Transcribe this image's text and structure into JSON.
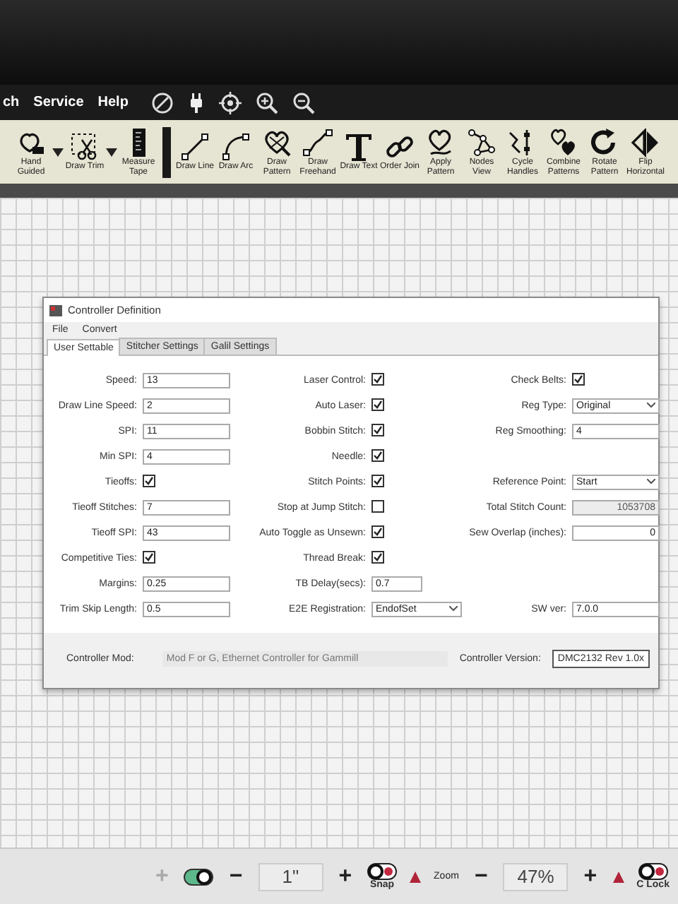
{
  "menu_bar": {
    "items": [
      "ch",
      "Service",
      "Help"
    ]
  },
  "toolbar": {
    "tools": [
      {
        "label": "Hand Guided",
        "dropdown": true
      },
      {
        "label": "Draw Trim",
        "dropdown": true
      },
      {
        "label": "Measure Tape",
        "dropdown": false
      },
      {
        "label": "Draw Line",
        "dropdown": false
      },
      {
        "label": "Draw Arc",
        "dropdown": false
      },
      {
        "label": "Draw Pattern",
        "dropdown": false
      },
      {
        "label": "Draw Freehand",
        "dropdown": false
      },
      {
        "label": "Draw Text",
        "dropdown": false
      },
      {
        "label": "Order Join",
        "dropdown": false
      },
      {
        "label": "Apply Pattern",
        "dropdown": false
      },
      {
        "label": "Nodes View",
        "dropdown": false
      },
      {
        "label": "Cycle Handles",
        "dropdown": false
      },
      {
        "label": "Combine Patterns",
        "dropdown": false
      },
      {
        "label": "Rotate Pattern",
        "dropdown": false
      },
      {
        "label": "Flip Horizontal",
        "dropdown": false
      }
    ]
  },
  "dialog": {
    "title": "Controller Definition",
    "menu": [
      "File",
      "Convert"
    ],
    "tabs": [
      {
        "label": "User Settable",
        "selected": true
      },
      {
        "label": "Stitcher Settings",
        "selected": false
      },
      {
        "label": "Galil Settings",
        "selected": false
      }
    ],
    "rows": [
      [
        {
          "label": "Speed:",
          "kind": "text",
          "value": "13"
        },
        {
          "label": "Laser Control:",
          "kind": "check",
          "checked": true
        },
        {
          "label": "Check Belts:",
          "kind": "check",
          "checked": true
        }
      ],
      [
        {
          "label": "Draw Line Speed:",
          "kind": "text",
          "value": "2"
        },
        {
          "label": "Auto Laser:",
          "kind": "check",
          "checked": true
        },
        {
          "label": "Reg Type:",
          "kind": "select",
          "value": "Original"
        }
      ],
      [
        {
          "label": "SPI:",
          "kind": "text",
          "value": "11"
        },
        {
          "label": "Bobbin Stitch:",
          "kind": "check",
          "checked": true
        },
        {
          "label": "Reg Smoothing:",
          "kind": "text",
          "value": "4"
        }
      ],
      [
        {
          "label": "Min SPI:",
          "kind": "text",
          "value": "4"
        },
        {
          "label": "Needle:",
          "kind": "check",
          "checked": true
        },
        null
      ],
      [
        {
          "label": "Tieoffs:",
          "kind": "check",
          "checked": true
        },
        {
          "label": "Stitch Points:",
          "kind": "check",
          "checked": true
        },
        {
          "label": "Reference Point:",
          "kind": "select",
          "value": "Start"
        }
      ],
      [
        {
          "label": "Tieoff Stitches:",
          "kind": "text",
          "value": "7"
        },
        {
          "label": "Stop at Jump Stitch:",
          "kind": "check",
          "checked": false
        },
        {
          "label": "Total Stitch Count:",
          "kind": "numeric",
          "value": "1053708",
          "disabled": true
        }
      ],
      [
        {
          "label": "Tieoff SPI:",
          "kind": "text",
          "value": "43"
        },
        {
          "label": "Auto Toggle as Unsewn:",
          "kind": "check",
          "checked": true
        },
        {
          "label": "Sew Overlap (inches):",
          "kind": "numeric",
          "value": "0",
          "disabled": false
        }
      ],
      [
        {
          "label": "Competitive Ties:",
          "kind": "check",
          "checked": true
        },
        {
          "label": "Thread Break:",
          "kind": "check",
          "checked": true
        },
        null
      ],
      [
        {
          "label": "Margins:",
          "kind": "text",
          "value": "0.25"
        },
        {
          "label": "TB Delay(secs):",
          "kind": "text",
          "value": "0.7"
        },
        null
      ],
      [
        {
          "label": "Trim Skip Length:",
          "kind": "text",
          "value": "0.5"
        },
        {
          "label": "E2E Registration:",
          "kind": "select",
          "value": "EndofSet"
        },
        {
          "label": "SW ver:",
          "kind": "text",
          "value": "7.0.0"
        }
      ]
    ],
    "footer": {
      "mod_label": "Controller Mod:",
      "mod_value": "Mod F or G, Ethernet Controller for Gammill",
      "version_label": "Controller Version:",
      "version_value": "DMC2132 Rev 1.0x"
    }
  },
  "status_bar": {
    "items": [
      {
        "kind": "button",
        "label": "+",
        "disabled": true
      },
      {
        "kind": "toggle",
        "on": true
      },
      {
        "kind": "button",
        "label": "−",
        "disabled": false
      },
      {
        "kind": "field",
        "value": "1\""
      },
      {
        "kind": "button",
        "label": "+",
        "disabled": false
      },
      {
        "kind": "toggle",
        "on": false,
        "label": "Snap"
      },
      {
        "kind": "marker"
      },
      {
        "kind": "text",
        "label": "Zoom"
      },
      {
        "kind": "button",
        "label": "−",
        "disabled": false
      },
      {
        "kind": "field",
        "value": "47%"
      },
      {
        "kind": "button",
        "label": "+",
        "disabled": false
      },
      {
        "kind": "marker"
      },
      {
        "kind": "toggle",
        "on": false,
        "label": "C Lock"
      }
    ]
  }
}
